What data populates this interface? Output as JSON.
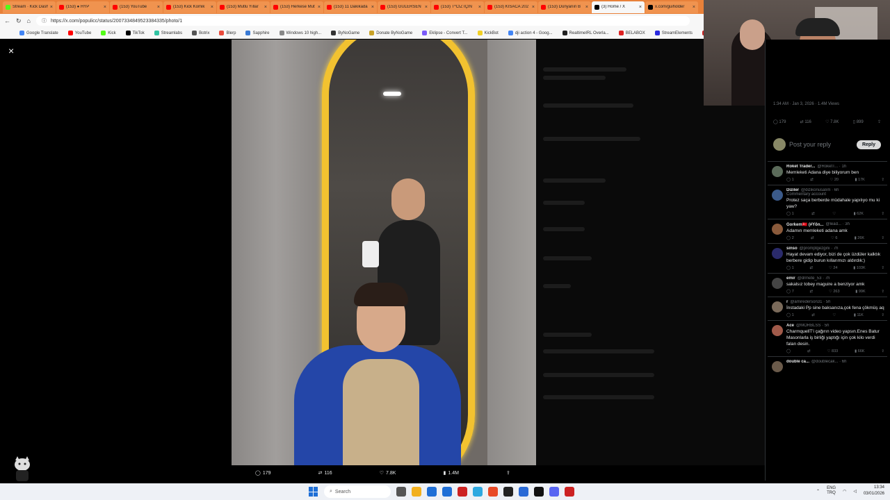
{
  "browser": {
    "tabs": [
      {
        "label": "Stream · Kick Dash",
        "color": "#53fc18"
      },
      {
        "label": "(153) ● HYP",
        "color": "#ff0000"
      },
      {
        "label": "(153) YouTube",
        "color": "#ff0000"
      },
      {
        "label": "(153) Kick Komik",
        "color": "#ff0000"
      },
      {
        "label": "(153) Mutlu Yıllar",
        "color": "#ff0000"
      },
      {
        "label": "(153) Herkese Mut",
        "color": "#ff0000"
      },
      {
        "label": "(153) 11 Dakikada",
        "color": "#ff0000"
      },
      {
        "label": "(153) GÜLERSEN",
        "color": "#ff0000"
      },
      {
        "label": "(153) T*CİZ İÇİN",
        "color": "#ff0000"
      },
      {
        "label": "(153) KISACA 202",
        "color": "#ff0000"
      },
      {
        "label": "(153) Dünyanın B",
        "color": "#ff0000"
      },
      {
        "label": "(3) Home / X",
        "color": "#000000"
      },
      {
        "label": "x.com/guiholder",
        "color": "#000000"
      }
    ],
    "active_tab_index": 11,
    "url": "https://x.com/populicc/status/2007334849523384335/photo/1",
    "bookmarks": [
      {
        "label": "Google Translate",
        "color": "#4285f4"
      },
      {
        "label": "YouTube",
        "color": "#ff0000"
      },
      {
        "label": "Kick",
        "color": "#53fc18"
      },
      {
        "label": "TikTok",
        "color": "#000000"
      },
      {
        "label": "Streamlabs",
        "color": "#31c3a2"
      },
      {
        "label": "Botrix",
        "color": "#555555"
      },
      {
        "label": "Blerp",
        "color": "#e94b3c"
      },
      {
        "label": "Sapphire",
        "color": "#3a7bd5"
      },
      {
        "label": "Windows 10 high...",
        "color": "#888888"
      },
      {
        "label": "ByNoGame",
        "color": "#333333"
      },
      {
        "label": "Donate ByNoGame",
        "color": "#c9a227"
      },
      {
        "label": "Eklipse - Convert T...",
        "color": "#7a5af8"
      },
      {
        "label": "KickBot",
        "color": "#f2d024"
      },
      {
        "label": "dji action 4 - Goog...",
        "color": "#4285f4"
      },
      {
        "label": "RealtimeIRL Overla...",
        "color": "#222222"
      },
      {
        "label": "BELABOX",
        "color": "#d22"
      },
      {
        "label": "StreamElements",
        "color": "#2a2adf"
      },
      {
        "label": "Ruf mich",
        "color": "#c22"
      }
    ]
  },
  "viewer": {
    "close_label": "×",
    "stats": [
      {
        "icon": "reply-icon",
        "glyph": "◯",
        "value": "179"
      },
      {
        "icon": "retweet-icon",
        "glyph": "⇄",
        "value": "116"
      },
      {
        "icon": "like-icon",
        "glyph": "♡",
        "value": "7.8K"
      },
      {
        "icon": "views-icon",
        "glyph": "▮",
        "value": "1.4M"
      },
      {
        "icon": "share-icon",
        "glyph": "⇪",
        "value": ""
      }
    ]
  },
  "sidebar": {
    "meta": "1:34 AM · Jan 3, 2026 · 1.4M Views",
    "actions": [
      {
        "glyph": "◯",
        "value": "179"
      },
      {
        "glyph": "⇄",
        "value": "116"
      },
      {
        "glyph": "♡",
        "value": "7.8K"
      },
      {
        "glyph": "▯",
        "value": "899"
      },
      {
        "glyph": "⇪",
        "value": ""
      }
    ],
    "reply_placeholder": "Post your reply",
    "reply_button": "Reply",
    "comments": [
      {
        "name": "Roket Trader...",
        "handle": "@RoketT... · 1h",
        "note": "",
        "text": "Memleketi Adana diye biliyorum ben",
        "replies": "1",
        "likes": "20",
        "views": "17K",
        "avatar": "#5b6b5a"
      },
      {
        "name": "Diziler",
        "handle": "@dizikonusalım · 6h",
        "note": "Commentary account",
        "text": "Protez saça berberde müdahale yapılıyo mu ki yaw?",
        "replies": "1",
        "likes": "",
        "views": "62K",
        "avatar": "#3b5a8a"
      },
      {
        "name": "Gorkem🇹🇷 (#Yön...",
        "handle": "@lead... · 3h",
        "note": "",
        "text": "Adamın memleketi adana amk",
        "replies": "2",
        "likes": "6",
        "views": "26K",
        "avatar": "#8a5a3b"
      },
      {
        "name": "sinso",
        "handle": "@promptgezgini · 7h",
        "note": "",
        "text": "Hayat devam ediyor, bizi de çok üzdüler kalktık berbere gidip burun kıllarımızı aldırdık:)",
        "replies": "1",
        "likes": "24",
        "views": "103K",
        "avatar": "#2a2a6a"
      },
      {
        "name": "emir",
        "handle": "@drmete_53 · 7h",
        "note": "",
        "text": "sakalsız tobey maguire a benziyor amk",
        "replies": "7",
        "likes": "263",
        "views": "99K",
        "avatar": "#444444"
      },
      {
        "name": "r",
        "handle": "@amirederson31 · 5h",
        "note": "",
        "text": "İnstadaki Pp sine baksanıza,çok fena çökmüş aq",
        "replies": "1",
        "likes": "",
        "views": "11K",
        "avatar": "#7a6a5a"
      },
      {
        "name": "Ace",
        "handle": "@MORBLSS · 5h",
        "note": "",
        "text": "CharmquellT'i çağırın video yapsın.Enes Batur Masonlarla iş birliği yaptığı için çok kilo verdi falan desin.",
        "replies": "",
        "likes": "833",
        "views": "66K",
        "avatar": "#a05a4a"
      },
      {
        "name": "double ca...",
        "handle": "@doublecak... · 6h",
        "note": "",
        "text": "",
        "replies": "",
        "likes": "",
        "views": "",
        "avatar": "#6a5a4a"
      }
    ]
  },
  "taskbar": {
    "search_label": "Search",
    "lang": "ENG\nTRQ",
    "time": "13:34",
    "date": "03/01/2026",
    "apps": [
      "#555555",
      "#f2b01e",
      "#1f6fd6",
      "#1f6fd6",
      "#c22",
      "#2da8e0",
      "#e84a27",
      "#222222",
      "#2a6ad6",
      "#111111",
      "#5865f2",
      "#c22"
    ]
  }
}
